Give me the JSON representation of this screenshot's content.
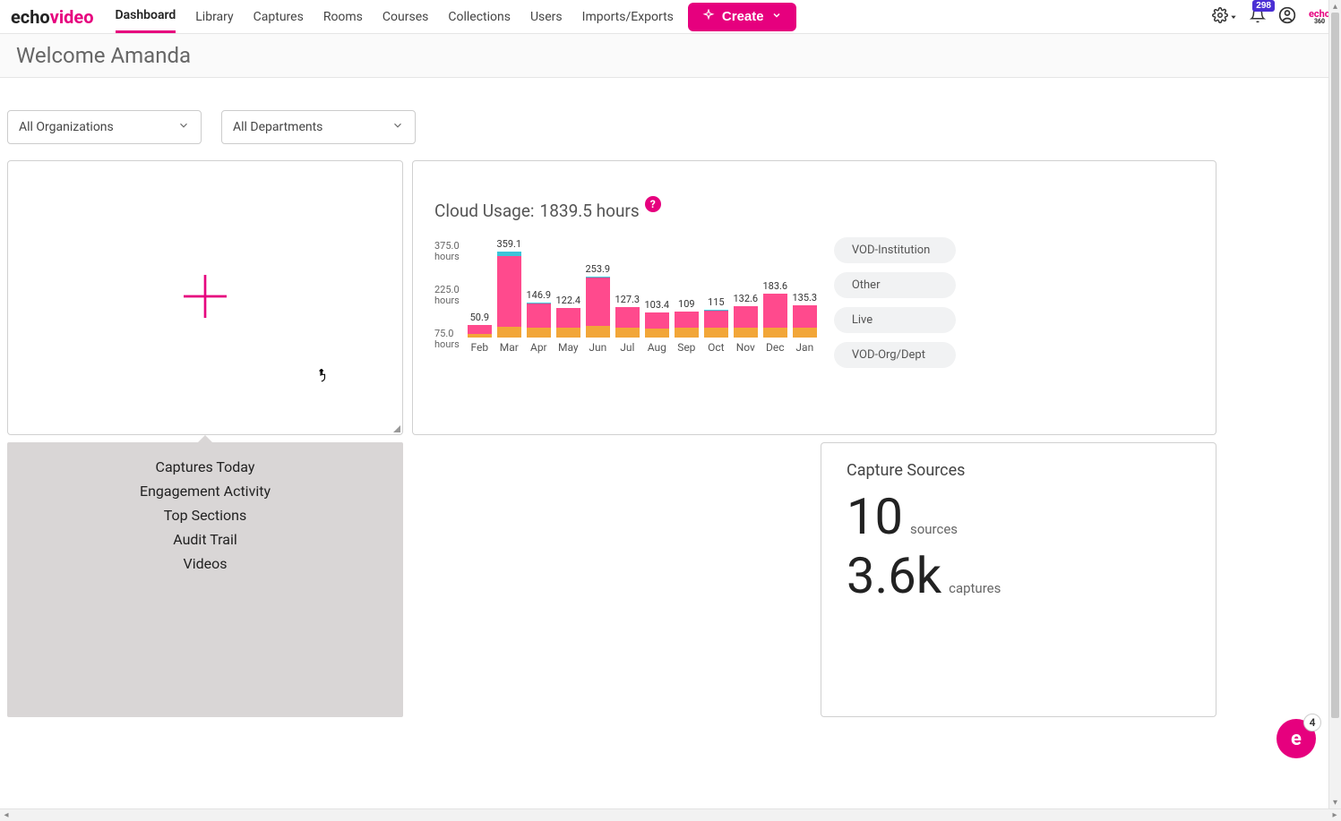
{
  "logo": {
    "part1": "echo",
    "part2": "video"
  },
  "nav": {
    "items": [
      "Dashboard",
      "Library",
      "Captures",
      "Rooms",
      "Courses",
      "Collections",
      "Users",
      "Imports/Exports"
    ],
    "active_index": 0
  },
  "create_button": "Create",
  "notifications_count": "298",
  "welcome": {
    "prefix": "Welcome ",
    "name": "Amanda"
  },
  "filters": {
    "organization": "All Organizations",
    "department": "All Departments"
  },
  "usage": {
    "title_prefix": "Cloud Usage: ",
    "total": "1839.5 hours",
    "legend": [
      "VOD-Institution",
      "Other",
      "Live",
      "VOD-Org/Dept"
    ],
    "y_ticks": [
      "375.0 hours",
      "225.0 hours",
      "75.0 hours"
    ]
  },
  "chart_data": {
    "type": "bar",
    "title": "Cloud Usage: 1839.5 hours",
    "xlabel": "",
    "ylabel": "hours",
    "ylim": [
      0,
      375
    ],
    "categories": [
      "Feb",
      "Mar",
      "Apr",
      "May",
      "Jun",
      "Jul",
      "Aug",
      "Sep",
      "Oct",
      "Nov",
      "Dec",
      "Jan"
    ],
    "series": [
      {
        "name": "VOD-Institution",
        "values": [
          36.9,
          297.1,
          100.9,
          82.4,
          201.9,
          85.3,
          64.4,
          66.0,
          72.0,
          89.6,
          141.6,
          92.3
        ]
      },
      {
        "name": "Other",
        "values": [
          0.0,
          8.0,
          2.0,
          0.0,
          2.0,
          0.0,
          0.0,
          0.0,
          2.0,
          0.0,
          0.0,
          0.0
        ]
      },
      {
        "name": "Live",
        "values": [
          0.0,
          10.0,
          2.0,
          0.0,
          0.0,
          0.0,
          0.0,
          0.0,
          0.0,
          0.0,
          0.0,
          0.0
        ]
      },
      {
        "name": "VOD-Org/Dept",
        "values": [
          14.0,
          44.0,
          42.0,
          40.0,
          50.0,
          42.0,
          39.0,
          43.0,
          41.0,
          43.0,
          42.0,
          43.0
        ]
      }
    ],
    "totals": [
      50.9,
      359.1,
      146.9,
      122.4,
      253.9,
      127.3,
      103.4,
      109.0,
      115.0,
      132.6,
      183.6,
      135.3
    ]
  },
  "add_menu": [
    "Captures Today",
    "Engagement Activity",
    "Top Sections",
    "Audit Trail",
    "Videos"
  ],
  "sources": {
    "title": "Capture Sources",
    "sources_count": "10",
    "sources_label": "sources",
    "captures_count": "3.6k",
    "captures_label": "captures"
  },
  "float_badge": "4",
  "colors": {
    "brand": "#e6007e",
    "seg_pink": "#ff4a8d",
    "seg_blue": "#3cc4d9",
    "seg_orange": "#f2a638",
    "notif_badge": "#4a2fd4"
  }
}
